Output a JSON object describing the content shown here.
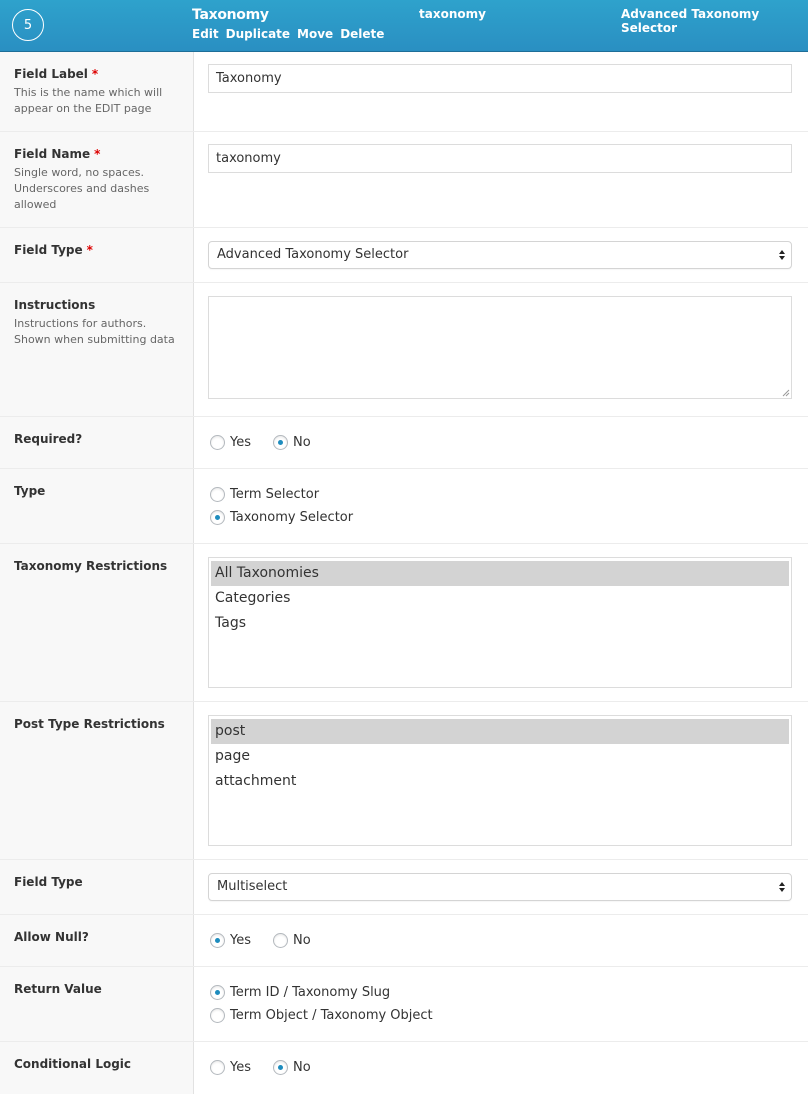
{
  "header": {
    "order": "5",
    "field_label": "Taxonomy",
    "actions": [
      "Edit",
      "Duplicate",
      "Move",
      "Delete"
    ],
    "field_name": "taxonomy",
    "field_type": "Advanced Taxonomy Selector"
  },
  "rows": {
    "field_label": {
      "label": "Field Label",
      "required_mark": "*",
      "description": "This is the name which will appear on the EDIT page",
      "value": "Taxonomy"
    },
    "field_name": {
      "label": "Field Name",
      "required_mark": "*",
      "description": "Single word, no spaces. Underscores and dashes allowed",
      "value": "taxonomy"
    },
    "field_type": {
      "label": "Field Type",
      "required_mark": "*",
      "selected": "Advanced Taxonomy Selector"
    },
    "instructions": {
      "label": "Instructions",
      "description": "Instructions for authors. Shown when submitting data",
      "value": ""
    },
    "required": {
      "label": "Required?",
      "options": [
        {
          "label": "Yes",
          "checked": false
        },
        {
          "label": "No",
          "checked": true
        }
      ]
    },
    "type": {
      "label": "Type",
      "options": [
        {
          "label": "Term Selector",
          "checked": false
        },
        {
          "label": "Taxonomy Selector",
          "checked": true
        }
      ]
    },
    "taxonomy_restrictions": {
      "label": "Taxonomy Restrictions",
      "options": [
        {
          "label": "All Taxonomies",
          "selected": true
        },
        {
          "label": "Categories",
          "selected": false
        },
        {
          "label": "Tags",
          "selected": false
        }
      ]
    },
    "post_type_restrictions": {
      "label": "Post Type Restrictions",
      "options": [
        {
          "label": "post",
          "selected": true
        },
        {
          "label": "page",
          "selected": false
        },
        {
          "label": "attachment",
          "selected": false
        }
      ]
    },
    "display_type": {
      "label": "Field Type",
      "selected": "Multiselect"
    },
    "allow_null": {
      "label": "Allow Null?",
      "options": [
        {
          "label": "Yes",
          "checked": true
        },
        {
          "label": "No",
          "checked": false
        }
      ]
    },
    "return_value": {
      "label": "Return Value",
      "options": [
        {
          "label": "Term ID / Taxonomy Slug",
          "checked": true
        },
        {
          "label": "Term Object / Taxonomy Object",
          "checked": false
        }
      ]
    },
    "conditional_logic": {
      "label": "Conditional Logic",
      "options": [
        {
          "label": "Yes",
          "checked": false
        },
        {
          "label": "No",
          "checked": true
        }
      ]
    }
  },
  "colors": {
    "header_bg": "#2ea2cc",
    "required": "#dd0000",
    "radio_dot": "#1e8cbe",
    "list_selected": "#d3d3d3"
  }
}
